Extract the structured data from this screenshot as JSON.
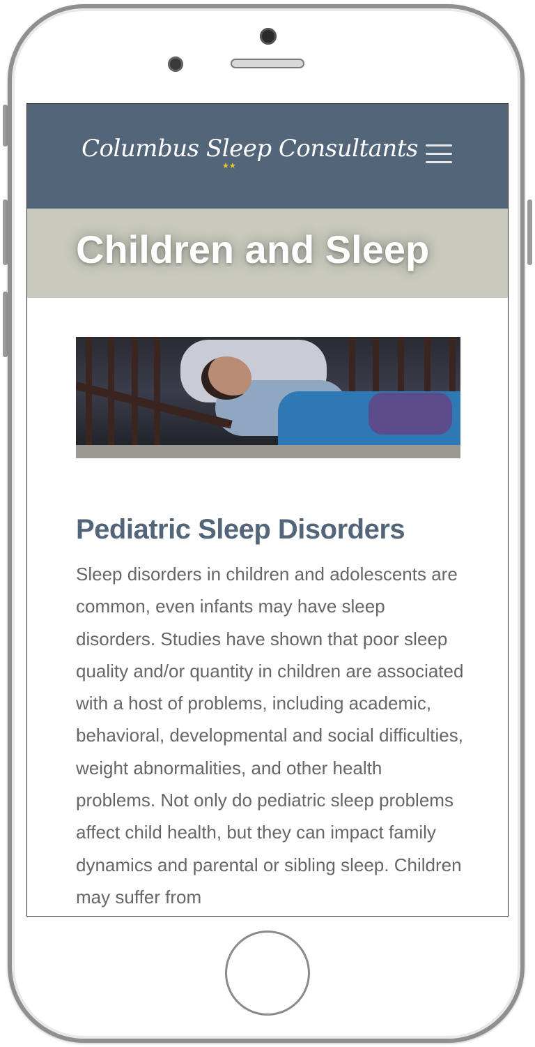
{
  "site": {
    "logo_text": "Columbus Sleep Consultants",
    "logo_stars": "★★",
    "menu_icon": "hamburger-menu-icon"
  },
  "page": {
    "title": "Children and Sleep"
  },
  "hero_image": {
    "description_icon": "sleeping-child-photo"
  },
  "article": {
    "heading": "Pediatric Sleep Disorders",
    "body": "Sleep disorders in children and adolescents are common, even infants may have sleep disorders. Studies have shown that poor sleep quality and/or quantity in children are associated with a host of problems, including academic, behavioral, developmental and social difficulties, weight abnormalities, and other health problems. Not only do pediatric sleep problems affect child health, but they can impact family dynamics and parental or sibling sleep. Children may suffer from"
  },
  "colors": {
    "header_bg": "#536679",
    "title_band_bg": "#c9cabd",
    "heading_color": "#536679",
    "body_text_color": "#66666a",
    "star_color": "#f2c531"
  }
}
